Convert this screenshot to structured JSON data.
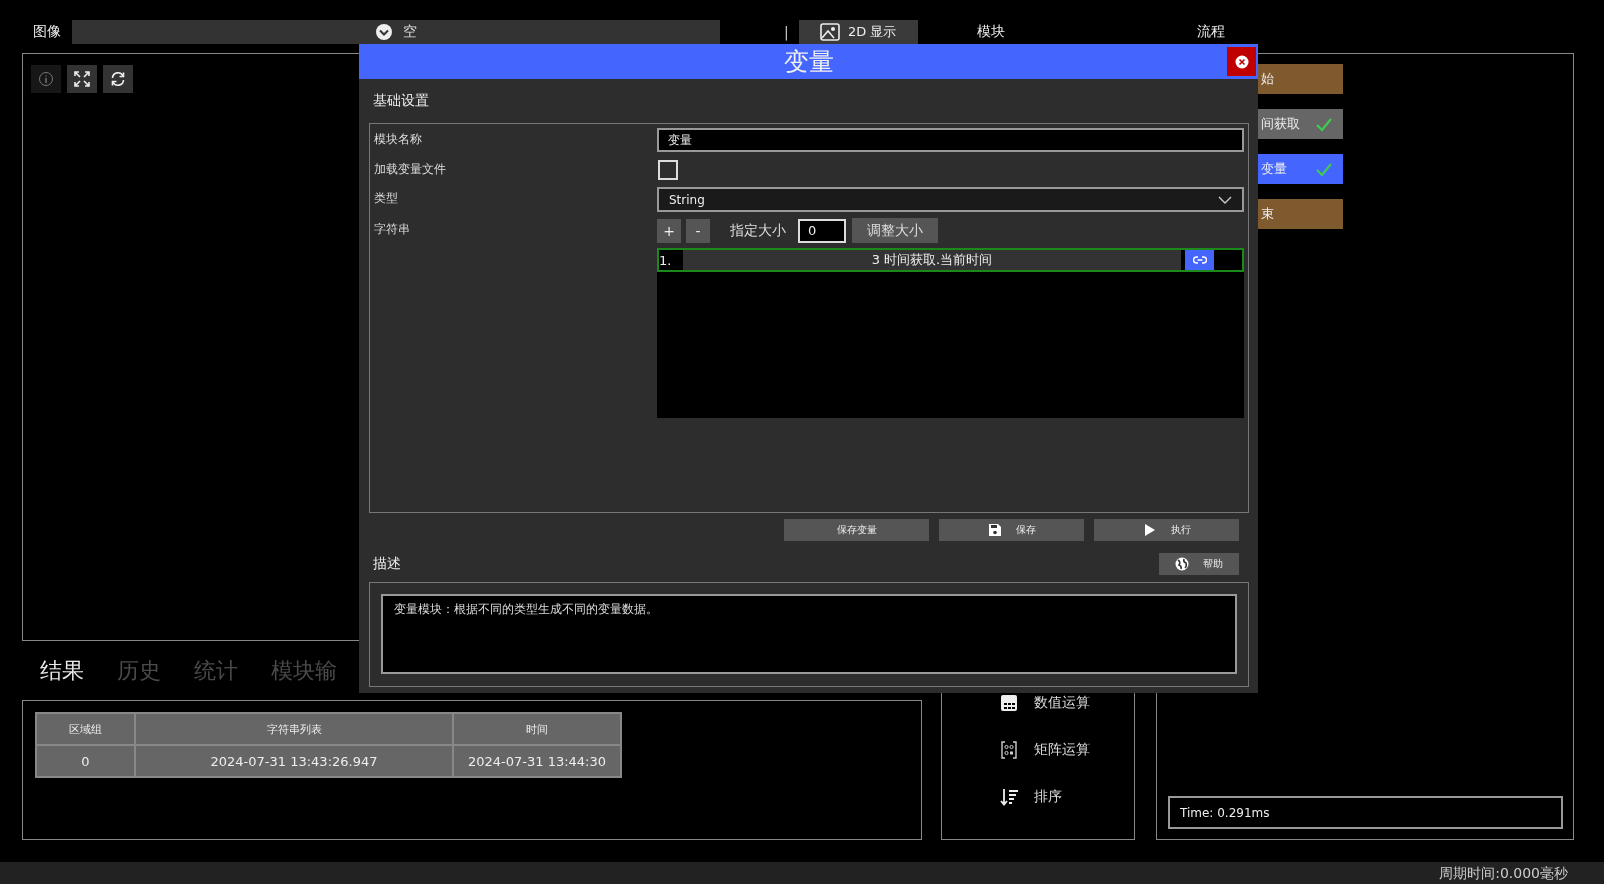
{
  "top_bar": {
    "image_label": "图像",
    "image_source": {
      "value": "空"
    },
    "separator": "|",
    "display_button": "2D 显示",
    "module_label": "模块",
    "flow_label": "流程"
  },
  "image_toolbar": [
    {
      "kind": "info",
      "disabled": true
    },
    {
      "kind": "fullscreen",
      "disabled": false
    },
    {
      "kind": "refresh",
      "disabled": false
    }
  ],
  "result_tabs": [
    {
      "label": "结果",
      "selected": true
    },
    {
      "label": "历史",
      "selected": false
    },
    {
      "label": "统计",
      "selected": false
    },
    {
      "label": "模块输",
      "selected": false
    }
  ],
  "result_table": {
    "columns": [
      "区域组",
      "字符串列表",
      "时间"
    ],
    "rows": [
      [
        "0",
        "2024-07-31 13:43:26.947",
        "2024-07-31 13:44:30"
      ]
    ]
  },
  "module_list": [
    {
      "label": "数值运算",
      "kind": "calc"
    },
    {
      "label": "矩阵运算",
      "kind": "matrix"
    },
    {
      "label": "排序",
      "kind": "sort"
    }
  ],
  "flow": {
    "nodes": [
      {
        "label": "始",
        "kind": "terminal",
        "selected": false,
        "checked": false
      },
      {
        "label": "间获取",
        "kind": "step",
        "selected": false,
        "checked": true
      },
      {
        "label": "变量",
        "kind": "step",
        "selected": true,
        "checked": true
      },
      {
        "label": "束",
        "kind": "terminal",
        "selected": false,
        "checked": false
      }
    ],
    "time": "Time: 0.291ms"
  },
  "status_bar": "周期时间:0.000毫秒",
  "dialog": {
    "title": "变量",
    "section": "基础设置",
    "fields": [
      {
        "label": "模块名称",
        "kind": "text",
        "value": "变量"
      },
      {
        "label": "加载变量文件",
        "kind": "checkbox",
        "checked": false
      },
      {
        "label": "类型",
        "kind": "select",
        "value": "String"
      },
      {
        "label": "字符串",
        "kind": "string_list",
        "add": "+",
        "remove": "-",
        "size_label": "指定大小",
        "size": "0",
        "resize": "调整大小",
        "items": [
          {
            "index": "1.",
            "value": "3 时间获取.当前时间"
          }
        ]
      }
    ],
    "buttons": [
      {
        "label": "保存变量",
        "kind": "plain"
      },
      {
        "label": "保存",
        "kind": "save"
      },
      {
        "label": "执行",
        "kind": "run"
      }
    ],
    "description_label": "描述",
    "help_button": "帮助",
    "description": "变量模块：根据不同的类型生成不同的变量数据。"
  }
}
